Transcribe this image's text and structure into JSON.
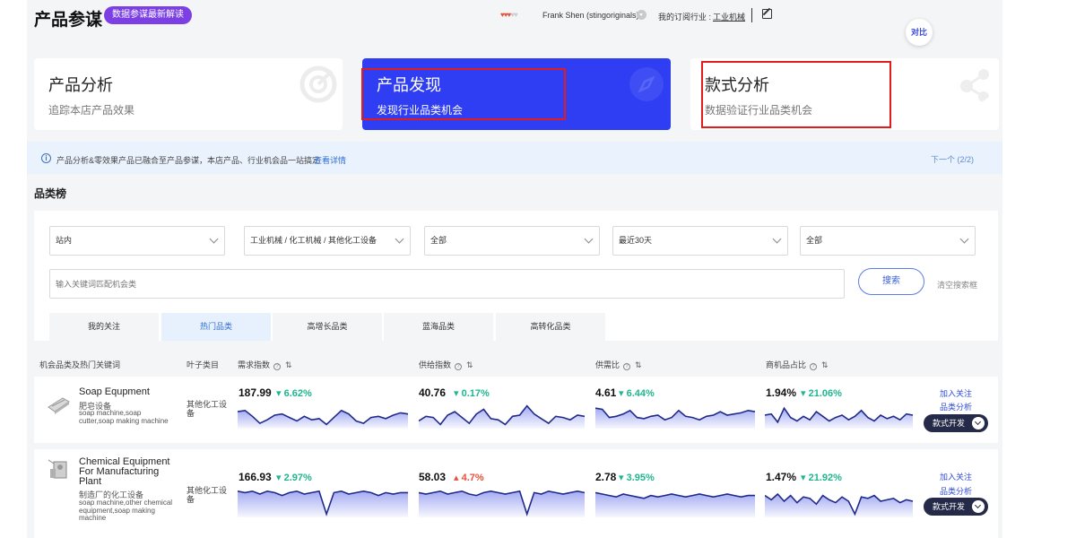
{
  "header": {
    "title": "产品参谋",
    "badge": "数据参谋最新解读",
    "hearts_filled": 3,
    "hearts_total": 5,
    "user": "Frank Shen (stingoriginals)",
    "industry_label": "我的订阅行业 :",
    "industry_value": "工业机械",
    "compare": "对比"
  },
  "cards": [
    {
      "title": "产品分析",
      "subtitle": "追踪本店产品效果"
    },
    {
      "title": "产品发现",
      "subtitle": "发现行业品类机会"
    },
    {
      "title": "款式分析",
      "subtitle": "数据验证行业品类机会"
    }
  ],
  "info": {
    "text": "产品分析&零效果产品已融合至产品参谋，本店产品、行业机会品一站搞定",
    "link": "查看详情",
    "pager": "下一个  (2/2)"
  },
  "section_title": "品类榜",
  "filters": {
    "site": "站内",
    "category": "工业机械 / 化工机械 / 其他化工设备",
    "all1": "全部",
    "period": "最近30天",
    "all2": "全部",
    "keyword_placeholder": "输入关键词匹配机会类",
    "search": "搜索",
    "clear": "清空搜索框"
  },
  "tabs": [
    "我的关注",
    "热门品类",
    "高增长品类",
    "蓝海品类",
    "高转化品类"
  ],
  "table": {
    "headers": {
      "category": "机会品类及热门关键词",
      "leaf": "叶子类目",
      "demand": "需求指数",
      "supply": "供给指数",
      "ratio": "供需比",
      "share": "商机品占比"
    },
    "rows": [
      {
        "name_en": "Soap Equpment",
        "name_cn": "肥皂设备",
        "keywords": "soap machine,soap cutter,soap making machine",
        "leaf": "其他化工设备",
        "metrics": [
          {
            "value": "187.99",
            "change": "6.62%",
            "dir": "down"
          },
          {
            "value": "40.76",
            "change": "0.17%",
            "dir": "down"
          },
          {
            "value": "4.61",
            "change": "6.44%",
            "dir": "down"
          },
          {
            "value": "1.94%",
            "change": "21.06%",
            "dir": "down"
          }
        ],
        "follow": "加入关注",
        "analysis": "品类分析",
        "develop": "款式开发"
      },
      {
        "name_en": "Chemical Equipment For Manufacturing Plant",
        "name_cn": "制造厂的化工设备",
        "keywords": "soap machine,other chemical equipment,soap making machine",
        "leaf": "其他化工设备",
        "metrics": [
          {
            "value": "166.93",
            "change": "2.97%",
            "dir": "down"
          },
          {
            "value": "58.03",
            "change": "4.7%",
            "dir": "up"
          },
          {
            "value": "2.78",
            "change": "3.95%",
            "dir": "down"
          },
          {
            "value": "1.47%",
            "change": "21.92%",
            "dir": "down"
          }
        ],
        "follow": "加入关注",
        "analysis": "品类分析",
        "develop": "款式开发"
      }
    ]
  },
  "colors": {
    "accent": "#2f3ef2",
    "badge": "#7b3fe4",
    "highlight": "#e31b1b",
    "trend_down": "#1fb68e",
    "trend_up": "#e8503a",
    "spark_line": "#1f2a8a",
    "button_dark": "#242a47"
  }
}
